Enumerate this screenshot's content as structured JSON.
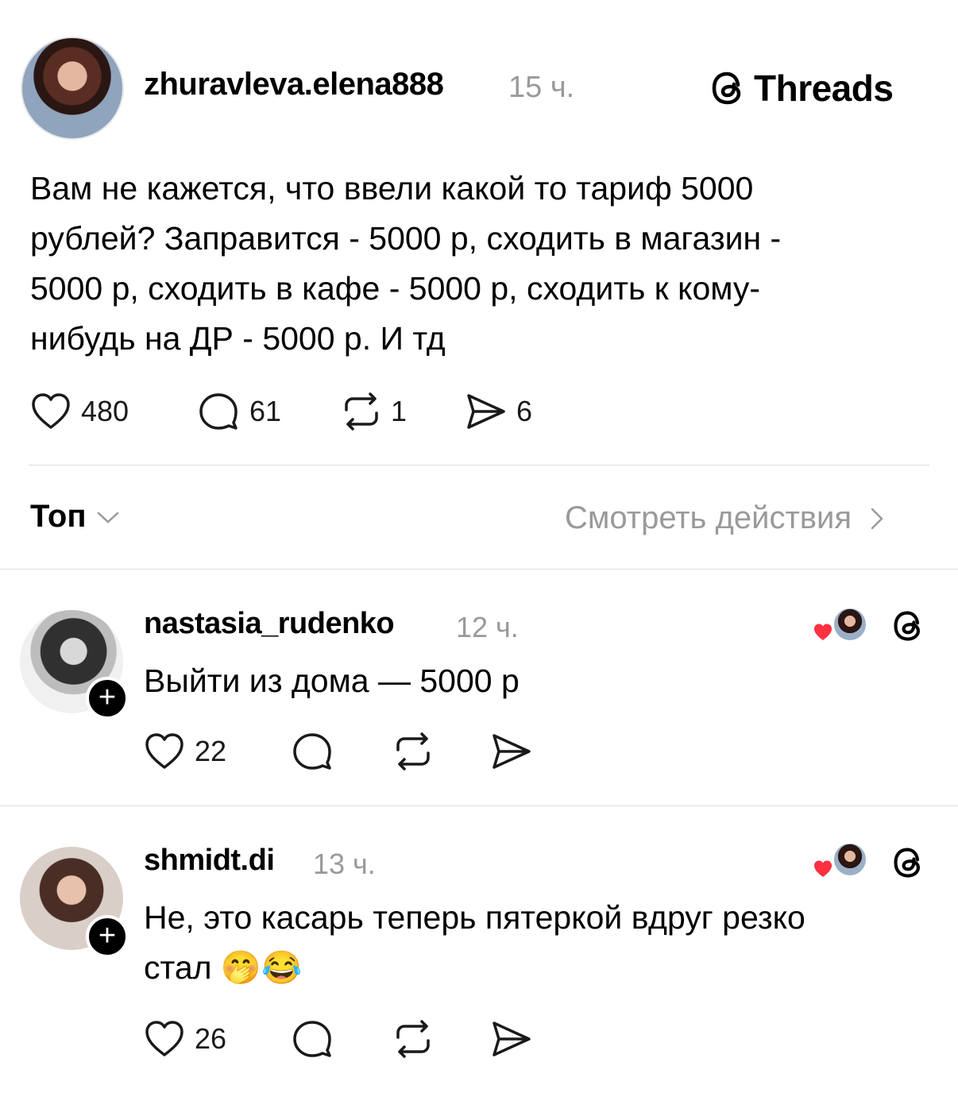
{
  "post": {
    "username": "zhuravleva.elena888",
    "time": "15 ч.",
    "text": "Вам не кажется, что ввели какой то тариф 5000 рублей? Заправится - 5000 р, сходить в магазин - 5000 р, сходить в кафе - 5000 р, сходить к кому-нибудь на ДР - 5000 р. И тд",
    "lines": [
      "Вам не кажется, что ввели какой то тариф 5000",
      "рублей? Заправится - 5000 р, сходить в магазин -",
      "5000 р, сходить в кафе - 5000 р, сходить к кому-",
      "нибудь на ДР - 5000 р. И тд"
    ],
    "likes": "480",
    "comments": "61",
    "reposts": "1",
    "shares": "6"
  },
  "brand": {
    "label": "Threads",
    "icon": "threads-logo-icon"
  },
  "sort": {
    "label": "Топ",
    "activity_link": "Смотреть действия"
  },
  "replies": [
    {
      "username": "nastasia_rudenko",
      "time": "12 ч.",
      "lines": [
        "Выйти из дома — 5000 р"
      ],
      "likes": "22"
    },
    {
      "username": "shmidt.di",
      "time": "13 ч.",
      "lines": [
        "Не, это касарь теперь пятеркой вдруг резко",
        "стал 🤭😂"
      ],
      "likes": "26"
    }
  ],
  "colors": {
    "heart": "#ff3040",
    "muted": "#9a9a9a",
    "divider": "#dcdcdc"
  }
}
